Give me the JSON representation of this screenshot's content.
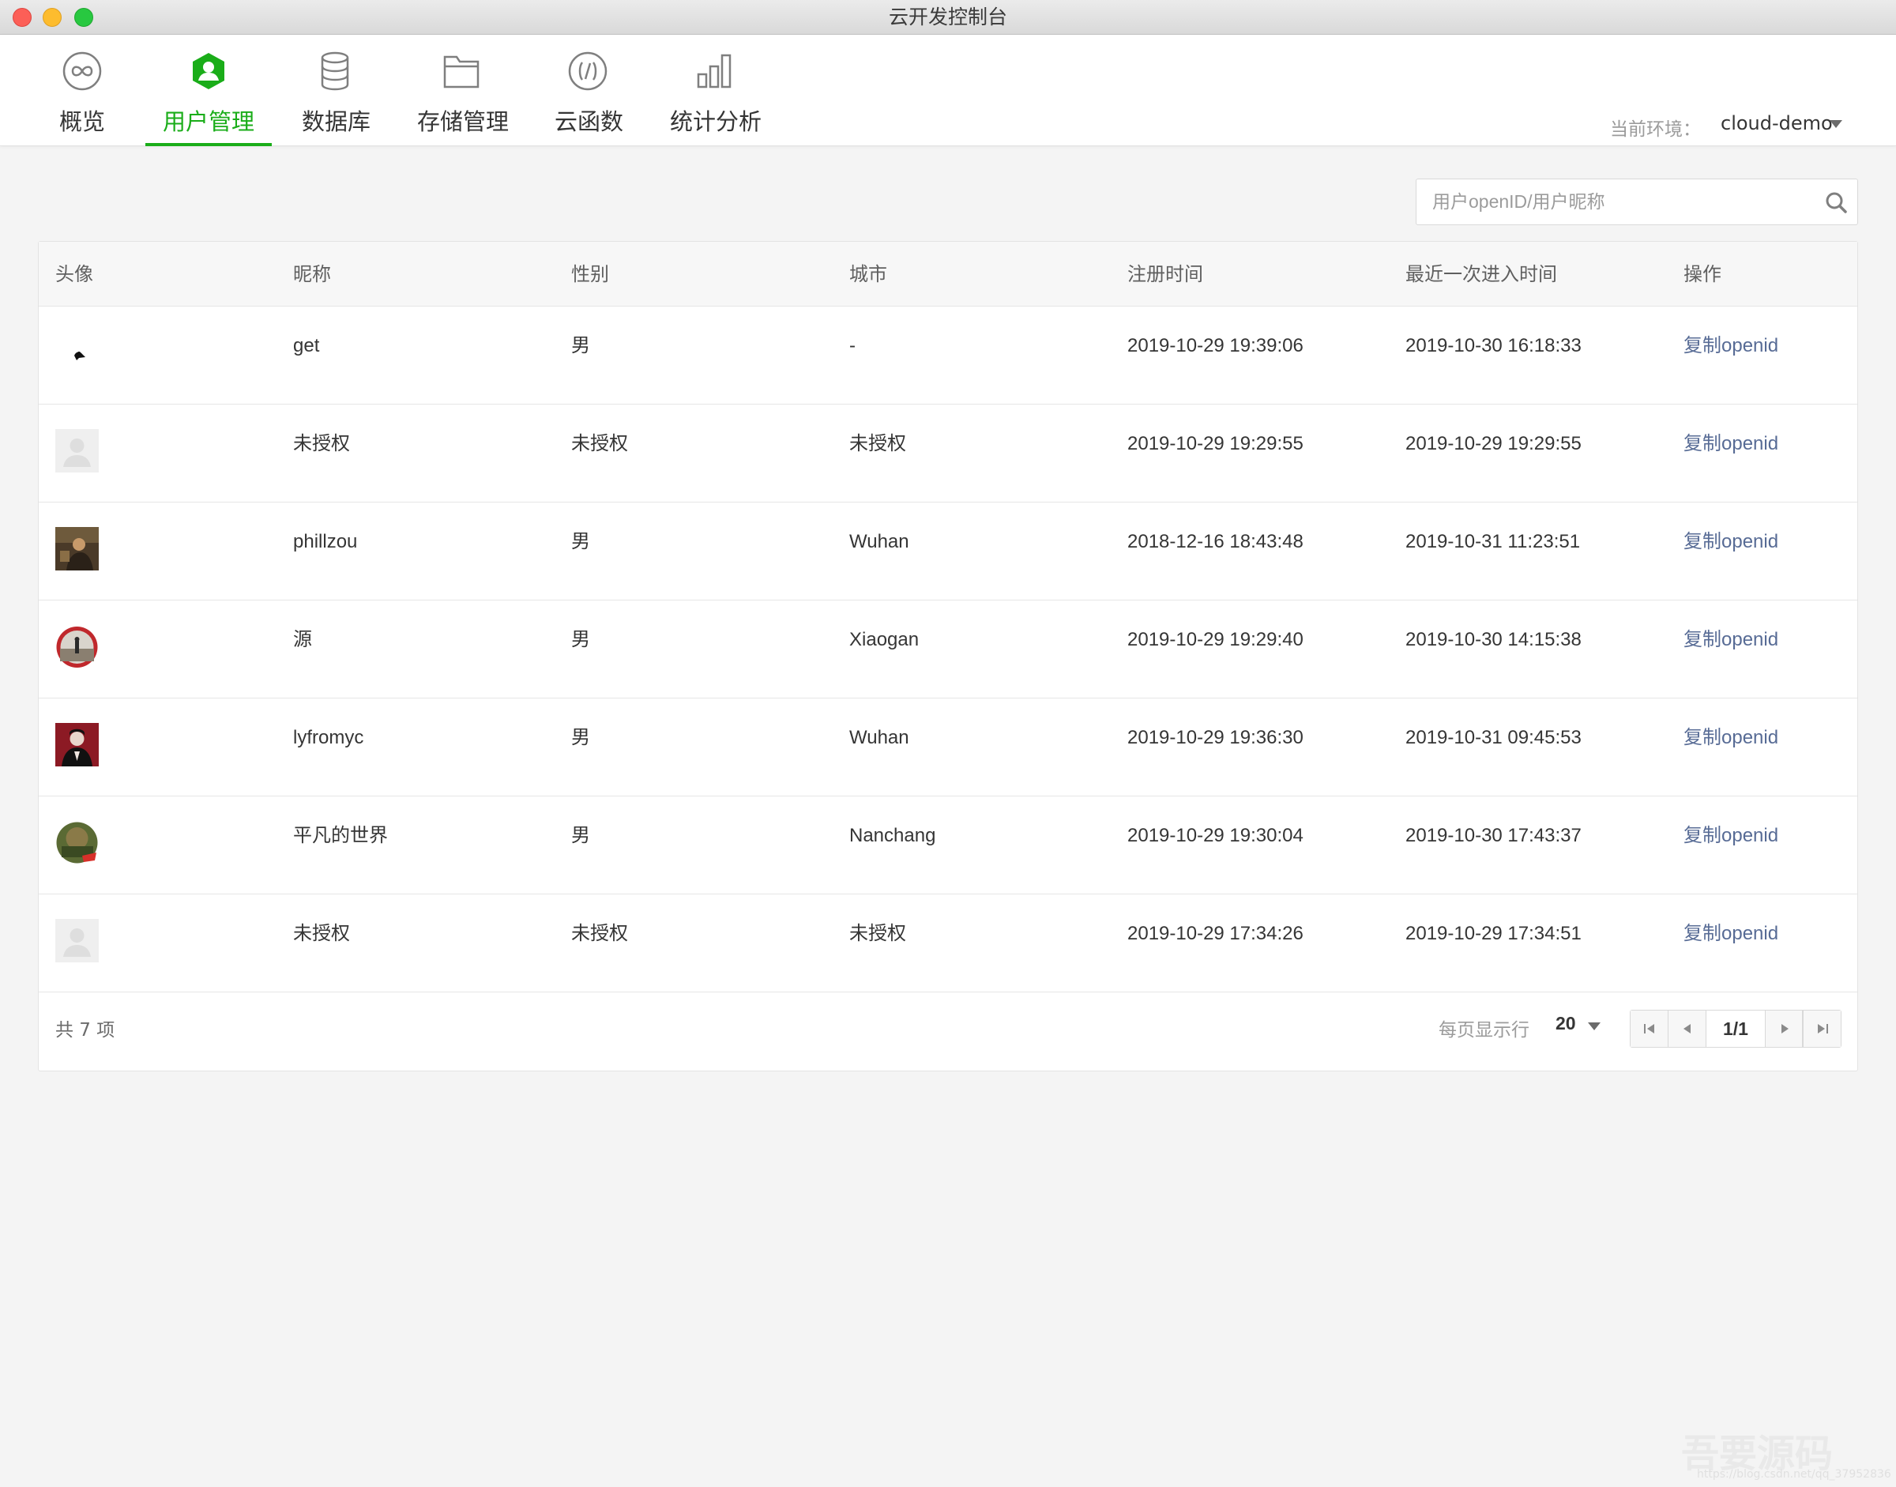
{
  "window": {
    "title": "云开发控制台"
  },
  "nav": {
    "items": [
      {
        "label": "概览",
        "icon": "overview-icon"
      },
      {
        "label": "用户管理",
        "icon": "user-icon",
        "active": true
      },
      {
        "label": "数据库",
        "icon": "database-icon"
      },
      {
        "label": "存储管理",
        "icon": "folder-icon"
      },
      {
        "label": "云函数",
        "icon": "cloud-function-icon"
      },
      {
        "label": "统计分析",
        "icon": "chart-icon"
      }
    ],
    "env_label": "当前环境：",
    "env_value": "cloud-demo"
  },
  "search": {
    "placeholder": "用户openID/用户昵称"
  },
  "table": {
    "columns": [
      "头像",
      "昵称",
      "性别",
      "城市",
      "注册时间",
      "最近一次进入时间",
      "操作"
    ],
    "rows": [
      {
        "avatar": "sparrow",
        "nickname": "get",
        "gender": "男",
        "city": "-",
        "registered": "2019-10-29 19:39:06",
        "last_visit": "2019-10-30 16:18:33",
        "action": "复制openid"
      },
      {
        "avatar": "placeholder",
        "nickname": "未授权",
        "gender": "未授权",
        "city": "未授权",
        "registered": "2019-10-29 19:29:55",
        "last_visit": "2019-10-29 19:29:55",
        "action": "复制openid"
      },
      {
        "avatar": "photo-brown",
        "nickname": "phillzou",
        "gender": "男",
        "city": "Wuhan",
        "registered": "2018-12-16 18:43:48",
        "last_visit": "2019-10-31 11:23:51",
        "action": "复制openid"
      },
      {
        "avatar": "photo-red-circle",
        "nickname": "源",
        "gender": "男",
        "city": "Xiaogan",
        "registered": "2019-10-29 19:29:40",
        "last_visit": "2019-10-30 14:15:38",
        "action": "复制openid"
      },
      {
        "avatar": "photo-red-portrait",
        "nickname": "lyfromyc",
        "gender": "男",
        "city": "Wuhan",
        "registered": "2019-10-29 19:36:30",
        "last_visit": "2019-10-31 09:45:53",
        "action": "复制openid"
      },
      {
        "avatar": "photo-green-circle",
        "nickname": "平凡的世界",
        "gender": "男",
        "city": "Nanchang",
        "registered": "2019-10-29 19:30:04",
        "last_visit": "2019-10-30 17:43:37",
        "action": "复制openid"
      },
      {
        "avatar": "placeholder",
        "nickname": "未授权",
        "gender": "未授权",
        "city": "未授权",
        "registered": "2019-10-29 17:34:26",
        "last_visit": "2019-10-29 17:34:51",
        "action": "复制openid"
      }
    ]
  },
  "footer": {
    "total": "共 7 项",
    "per_page_label": "每页显示行",
    "per_page_value": "20",
    "page": "1/1"
  },
  "watermark": {
    "text": "吾要源码",
    "url": "https://blog.csdn.net/qq_37952836"
  },
  "colors": {
    "accent": "#1aad19",
    "link": "#576b95"
  }
}
